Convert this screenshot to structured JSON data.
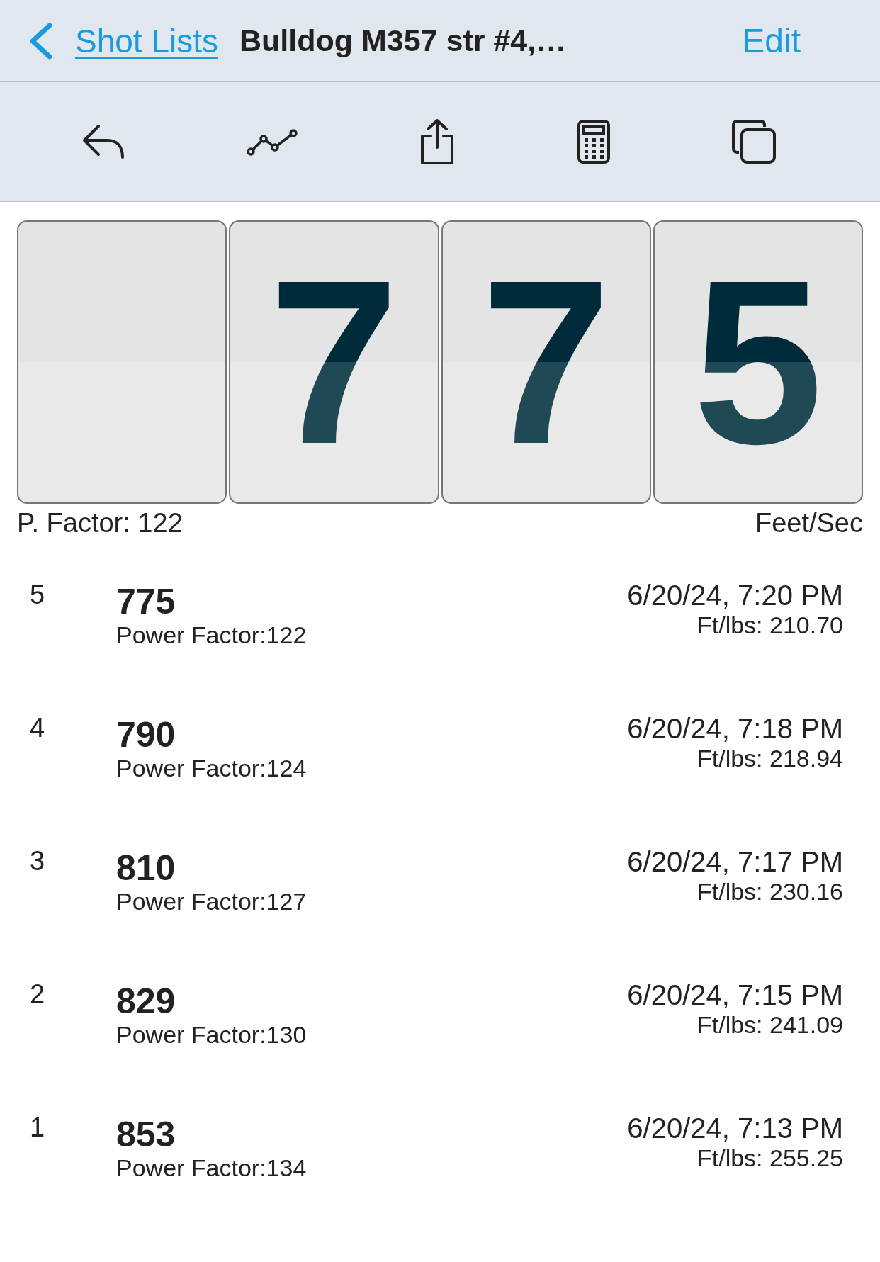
{
  "nav": {
    "back_label": "Shot Lists",
    "title": "Bulldog M357 str #4,…",
    "action": "Edit"
  },
  "display": {
    "boxes": [
      {
        "kind": "blank"
      },
      {
        "kind": "digit",
        "digit": "7"
      },
      {
        "kind": "digit",
        "digit": "7"
      },
      {
        "kind": "digit",
        "digit": "5"
      }
    ],
    "left_caption": "P. Factor: 122",
    "right_caption": "Feet/Sec"
  },
  "shots": [
    {
      "index": "5",
      "velocity": "775",
      "power_factor": "Power Factor:122",
      "time": "6/20/24, 7:20 PM",
      "energy": "Ft/lbs: 210.70"
    },
    {
      "index": "4",
      "velocity": "790",
      "power_factor": "Power Factor:124",
      "time": "6/20/24, 7:18 PM",
      "energy": "Ft/lbs: 218.94"
    },
    {
      "index": "3",
      "velocity": "810",
      "power_factor": "Power Factor:127",
      "time": "6/20/24, 7:17 PM",
      "energy": "Ft/lbs: 230.16"
    },
    {
      "index": "2",
      "velocity": "829",
      "power_factor": "Power Factor:130",
      "time": "6/20/24, 7:15 PM",
      "energy": "Ft/lbs: 241.09"
    },
    {
      "index": "1",
      "velocity": "853",
      "power_factor": "Power Factor:134",
      "time": "6/20/24, 7:13 PM",
      "energy": "Ft/lbs: 255.25"
    }
  ]
}
